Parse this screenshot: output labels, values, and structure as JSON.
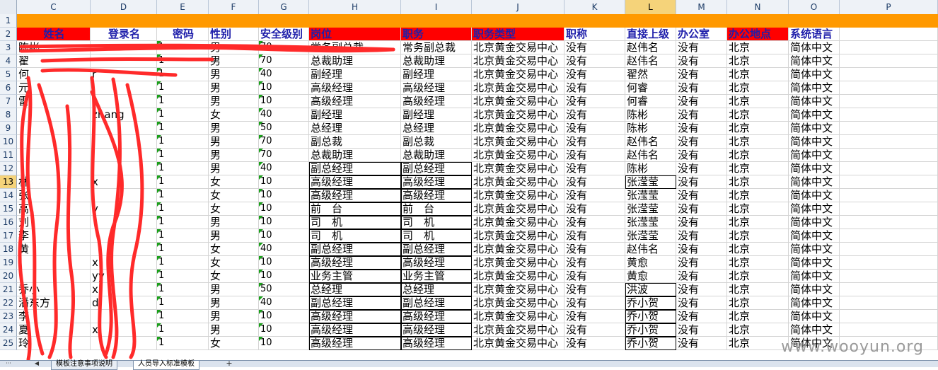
{
  "columns": [
    "C",
    "D",
    "E",
    "F",
    "G",
    "H",
    "I",
    "J",
    "K",
    "L",
    "M",
    "N",
    "O",
    "P"
  ],
  "active_column": "L",
  "rows": [
    "1",
    "2",
    "3",
    "4",
    "5",
    "6",
    "7",
    "8",
    "9",
    "10",
    "11",
    "12",
    "13",
    "14",
    "15",
    "16",
    "17",
    "18",
    "19",
    "20",
    "21",
    "22",
    "23",
    "24",
    "25"
  ],
  "active_row": "13",
  "headers": {
    "C": "姓名",
    "D": "登录名",
    "E": "密码",
    "F": "性别",
    "G": "安全级别",
    "H": "岗位",
    "I": "职务",
    "J": "职务类型",
    "K": "职称",
    "L": "直接上级",
    "M": "办公室",
    "N": "办公地点",
    "O": "系统语言"
  },
  "data_rows": [
    {
      "row": "3",
      "C": "陈彬",
      "D": "",
      "E": "1",
      "F": "男",
      "G": "70",
      "H": "常务副总裁",
      "I": "常务副总裁",
      "J": "北京黄金交易中心",
      "K": "没有",
      "L": "赵伟名",
      "M": "没有",
      "N": "北京",
      "O": "简体中文"
    },
    {
      "row": "4",
      "C": "翟",
      "D": "",
      "E": "1",
      "F": "男",
      "G": "70",
      "H": "总裁助理",
      "I": "总裁助理",
      "J": "北京黄金交易中心",
      "K": "没有",
      "L": "赵伟名",
      "M": "没有",
      "N": "北京",
      "O": "简体中文"
    },
    {
      "row": "5",
      "C": "何",
      "D": "r",
      "E": "1",
      "F": "男",
      "G": "40",
      "H": "副经理",
      "I": "副经理",
      "J": "北京黄金交易中心",
      "K": "没有",
      "L": "翟然",
      "M": "没有",
      "N": "北京",
      "O": "简体中文"
    },
    {
      "row": "6",
      "C": "元",
      "D": "j",
      "E": "1",
      "F": "男",
      "G": "10",
      "H": "高级经理",
      "I": "高级经理",
      "J": "北京黄金交易中心",
      "K": "没有",
      "L": "何睿",
      "M": "没有",
      "N": "北京",
      "O": "简体中文"
    },
    {
      "row": "7",
      "C": "雷",
      "D": "",
      "E": "1",
      "F": "男",
      "G": "10",
      "H": "高级经理",
      "I": "高级经理",
      "J": "北京黄金交易中心",
      "K": "没有",
      "L": "何睿",
      "M": "没有",
      "N": "北京",
      "O": "简体中文"
    },
    {
      "row": "8",
      "C": "",
      "D": "zhang",
      "E": "1",
      "F": "女",
      "G": "40",
      "H": "副经理",
      "I": "副经理",
      "J": "北京黄金交易中心",
      "K": "没有",
      "L": "陈彬",
      "M": "没有",
      "N": "北京",
      "O": "简体中文"
    },
    {
      "row": "9",
      "C": "",
      "D": "",
      "E": "1",
      "F": "男",
      "G": "50",
      "H": "总经理",
      "I": "总经理",
      "J": "北京黄金交易中心",
      "K": "没有",
      "L": "陈彬",
      "M": "没有",
      "N": "北京",
      "O": "简体中文"
    },
    {
      "row": "10",
      "C": "",
      "D": "",
      "E": "1",
      "F": "男",
      "G": "70",
      "H": "副总裁",
      "I": "副总裁",
      "J": "北京黄金交易中心",
      "K": "没有",
      "L": "赵伟名",
      "M": "没有",
      "N": "北京",
      "O": "简体中文"
    },
    {
      "row": "11",
      "C": "",
      "D": "",
      "E": "1",
      "F": "男",
      "G": "70",
      "H": "总裁助理",
      "I": "总裁助理",
      "J": "北京黄金交易中心",
      "K": "没有",
      "L": "赵伟名",
      "M": "没有",
      "N": "北京",
      "O": "简体中文"
    },
    {
      "row": "12",
      "C": "",
      "D": "",
      "E": "1",
      "F": "男",
      "G": "40",
      "H": "副总经理",
      "I": "副总经理",
      "J": "北京黄金交易中心",
      "K": "没有",
      "L": "陈彬",
      "M": "没有",
      "N": "北京",
      "O": "简体中文"
    },
    {
      "row": "13",
      "C": "林",
      "D": "x",
      "E": "1",
      "F": "女",
      "G": "10",
      "H": "高级经理",
      "I": "高级经理",
      "J": "北京黄金交易中心",
      "K": "没有",
      "L": "张滢莹",
      "M": "没有",
      "N": "北京",
      "O": "简体中文"
    },
    {
      "row": "14",
      "C": "张",
      "D": "",
      "E": "1",
      "F": "女",
      "G": "10",
      "H": "高级经理",
      "I": "高级经理",
      "J": "北京黄金交易中心",
      "K": "没有",
      "L": "张滢莹",
      "M": "没有",
      "N": "北京",
      "O": "简体中文"
    },
    {
      "row": "15",
      "C": "高",
      "D": "y",
      "E": "1",
      "F": "女",
      "G": "10",
      "H": "前　台",
      "I": "前　台",
      "J": "北京黄金交易中心",
      "K": "没有",
      "L": "张滢莹",
      "M": "没有",
      "N": "北京",
      "O": "简体中文"
    },
    {
      "row": "16",
      "C": "刘",
      "D": "",
      "E": "1",
      "F": "男",
      "G": "10",
      "H": "司　机",
      "I": "司　机",
      "J": "北京黄金交易中心",
      "K": "没有",
      "L": "张滢莹",
      "M": "没有",
      "N": "北京",
      "O": "简体中文"
    },
    {
      "row": "17",
      "C": "李",
      "D": "",
      "E": "1",
      "F": "男",
      "G": "10",
      "H": "司　机",
      "I": "司　机",
      "J": "北京黄金交易中心",
      "K": "没有",
      "L": "张滢莹",
      "M": "没有",
      "N": "北京",
      "O": "简体中文"
    },
    {
      "row": "18",
      "C": "黄",
      "D": "",
      "E": "1",
      "F": "女",
      "G": "40",
      "H": "副总经理",
      "I": "副总经理",
      "J": "北京黄金交易中心",
      "K": "没有",
      "L": "赵伟名",
      "M": "没有",
      "N": "北京",
      "O": "简体中文"
    },
    {
      "row": "19",
      "C": "",
      "D": "x",
      "E": "1",
      "F": "女",
      "G": "10",
      "H": "高级经理",
      "I": "高级经理",
      "J": "北京黄金交易中心",
      "K": "没有",
      "L": "黄愈",
      "M": "没有",
      "N": "北京",
      "O": "简体中文"
    },
    {
      "row": "20",
      "C": "",
      "D": "yy",
      "E": "1",
      "F": "女",
      "G": "10",
      "H": "业务主管",
      "I": "业务主管",
      "J": "北京黄金交易中心",
      "K": "没有",
      "L": "黄愈",
      "M": "没有",
      "N": "北京",
      "O": "简体中文"
    },
    {
      "row": "21",
      "C": "乔小",
      "D": "xl",
      "E": "1",
      "F": "男",
      "G": "50",
      "H": "总经理",
      "I": "总经理",
      "J": "北京黄金交易中心",
      "K": "没有",
      "L": "洪波",
      "M": "没有",
      "N": "北京",
      "O": "简体中文"
    },
    {
      "row": "22",
      "C": "潘东方",
      "D": "d",
      "E": "1",
      "F": "男",
      "G": "40",
      "H": "副总经理",
      "I": "副总经理",
      "J": "北京黄金交易中心",
      "K": "没有",
      "L": "乔小贺",
      "M": "没有",
      "N": "北京",
      "O": "简体中文"
    },
    {
      "row": "23",
      "C": "李",
      "D": "",
      "E": "1",
      "F": "男",
      "G": "10",
      "H": "高级经理",
      "I": "高级经理",
      "J": "北京黄金交易中心",
      "K": "没有",
      "L": "乔小贺",
      "M": "没有",
      "N": "北京",
      "O": "简体中文"
    },
    {
      "row": "24",
      "C": "夏",
      "D": "xi",
      "E": "1",
      "F": "男",
      "G": "10",
      "H": "高级经理",
      "I": "高级经理",
      "J": "北京黄金交易中心",
      "K": "没有",
      "L": "乔小贺",
      "M": "没有",
      "N": "北京",
      "O": "简体中文"
    },
    {
      "row": "25",
      "C": "玲",
      "D": "",
      "E": "1",
      "F": "女",
      "G": "10",
      "H": "高级经理",
      "I": "高级经理",
      "J": "北京黄金交易中心",
      "K": "没有",
      "L": "乔小贺",
      "M": "没有",
      "N": "北京",
      "O": "简体中文"
    }
  ],
  "sheet_tabs": [
    "模板注意事项说明",
    "人员导入标准模板"
  ],
  "active_tab": 1,
  "nav": {
    "prev": "◀",
    "dots": "···",
    "add": "+"
  },
  "colors": {
    "header_red": "#ff0000",
    "orange_band": "#ff9900",
    "scribble": "#ff2a2a",
    "header_text": "#1e1eaa"
  },
  "watermark": "www.wooyun.org"
}
